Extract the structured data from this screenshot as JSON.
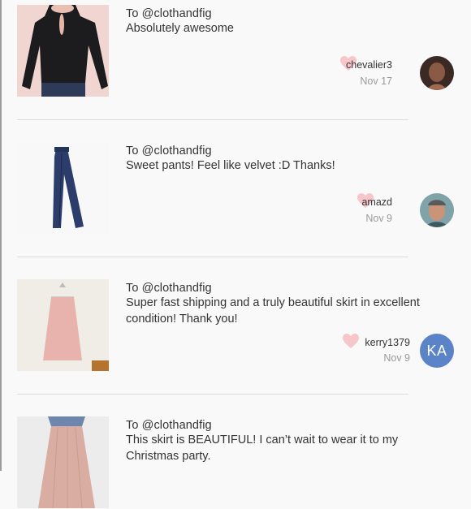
{
  "comments": [
    {
      "to": "To @clothandfig",
      "message": "Absolutely awesome",
      "username": "chevalier3",
      "date": "Nov 17",
      "item_image": "black-long-sleeve-top",
      "avatar": "photo"
    },
    {
      "to": "To @clothandfig",
      "message": "Sweet pants! Feel like velvet :D Thanks!",
      "username": "amazd",
      "date": "Nov 9",
      "item_image": "navy-velvet-pants",
      "avatar": "photo"
    },
    {
      "to": "To @clothandfig",
      "message": "Super fast shipping and a truly beautiful skirt in excellent condition! Thank you!",
      "username": "kerry1379",
      "date": "Nov 9",
      "item_image": "pink-skirt",
      "avatar": "initials",
      "avatar_initials": "KA"
    },
    {
      "to": "To @clothandfig",
      "message": "This skirt is BEAUTIFUL! I can’t wait to wear it to my Christmas party.",
      "item_image": "pleated-tulle-skirt"
    }
  ],
  "colors": {
    "heart": "#f6c6cb",
    "avatar_bg": "#5b84c8",
    "divider": "#dcdcdc",
    "date": "#9a9a9a"
  },
  "icons": {
    "like": "heart-icon"
  }
}
